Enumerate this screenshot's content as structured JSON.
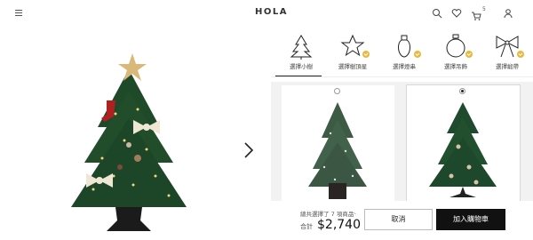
{
  "header": {
    "logo": "HOLA",
    "cart_count": "5"
  },
  "categories": [
    {
      "label": "選擇小樹",
      "icon": "tree-icon",
      "checked": false,
      "active": true
    },
    {
      "label": "選擇樹頂星",
      "icon": "star-icon",
      "checked": true,
      "active": false
    },
    {
      "label": "選擇燈串",
      "icon": "light-bulb-icon",
      "checked": true,
      "active": false
    },
    {
      "label": "選擇吊飾",
      "icon": "ornament-ball-icon",
      "checked": true,
      "active": false
    },
    {
      "label": "選擇緞帶",
      "icon": "ribbon-bow-icon",
      "checked": true,
      "active": false
    }
  ],
  "products": [
    {
      "name": "plain-tree-in-pot",
      "selected": false
    },
    {
      "name": "decorated-tree-on-stand",
      "selected": true
    }
  ],
  "bottom_bar": {
    "summary": "總共選擇了 7 項商品",
    "total_label": "合計",
    "total_value": "$2,740",
    "cancel_label": "取消",
    "add_to_cart_label": "加入購物車"
  },
  "colors": {
    "accent_check": "#e8b93b",
    "primary_button": "#111111",
    "grid_background": "#f2f2f2"
  }
}
